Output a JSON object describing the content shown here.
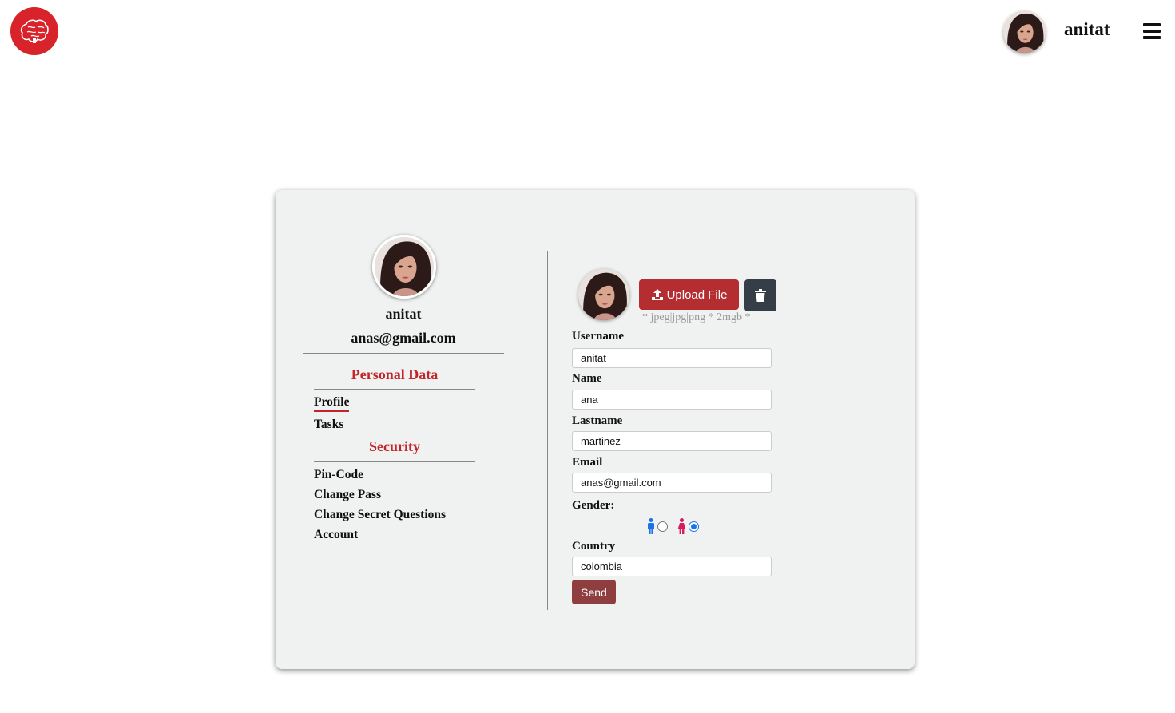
{
  "colors": {
    "brand_red": "#d9232a",
    "section_red": "#c2242a",
    "upload_button": "#b32d31",
    "trash_button": "#353d46",
    "send_button": "#8e3e3e",
    "card_background": "#f0f1f1",
    "radio_selected": "#1a73e8",
    "male_icon": "#1a73e8",
    "female_icon": "#d81b60"
  },
  "header": {
    "logo_icon": "brain-icon",
    "avatar_icon": "user-avatar",
    "username": "anitat",
    "menu_icon": "hamburger-menu-icon"
  },
  "sidebar": {
    "username": "anitat",
    "email": "anas@gmail.com",
    "personal_data_title": "Personal Data",
    "personal_items": [
      {
        "label": "Profile",
        "active": true
      },
      {
        "label": "Tasks",
        "active": false
      }
    ],
    "security_title": "Security",
    "security_items": [
      {
        "label": "Pin-Code"
      },
      {
        "label": "Change Pass"
      },
      {
        "label": "Change Secret Questions"
      },
      {
        "label": "Account"
      }
    ]
  },
  "form": {
    "upload_label": "Upload File",
    "upload_icon": "upload-icon",
    "delete_icon": "trash-icon",
    "file_hint": "* jpeg|jpg|png * 2mgb *",
    "username_label": "Username",
    "username_value": "anitat",
    "name_label": "Name",
    "name_value": "ana",
    "lastname_label": "Lastname",
    "lastname_value": "martinez",
    "email_label": "Email",
    "email_value": "anas@gmail.com",
    "gender_label": "Gender:",
    "gender_options": [
      {
        "icon": "male-icon",
        "checked": false
      },
      {
        "icon": "female-icon",
        "checked": true
      }
    ],
    "country_label": "Country",
    "country_value": "colombia",
    "send_label": "Send"
  }
}
